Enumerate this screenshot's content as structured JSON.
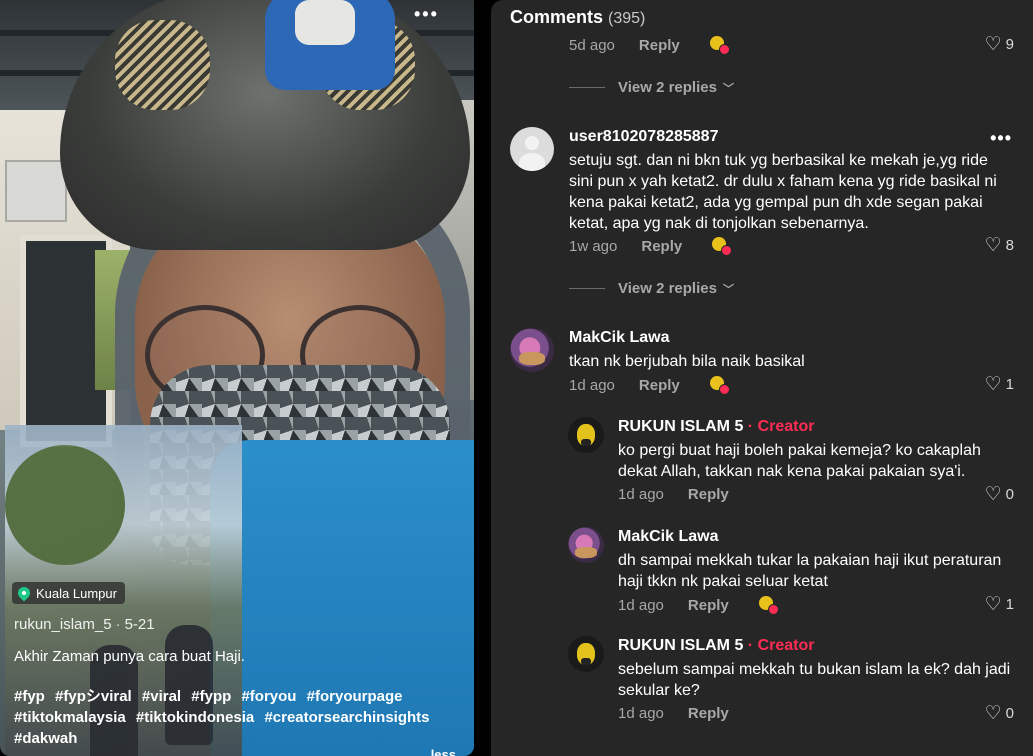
{
  "video": {
    "location": "Kuala Lumpur",
    "author": "rukun_islam_5",
    "date": "5-21",
    "caption": "Akhir Zaman punya cara buat Haji.",
    "hashtags": [
      "#fyp",
      "#fypシviral",
      "#viral",
      "#fypp",
      "#foryou",
      "#foryourpage",
      "#tiktokmalaysia",
      "#tiktokindonesia",
      "#creatorsearchinsights",
      "#dakwah"
    ],
    "more_label": "less"
  },
  "comments_panel": {
    "title": "Comments",
    "count": "(395)",
    "partial_top": {
      "time": "5d ago",
      "reply": "Reply",
      "likes": "9"
    },
    "view_replies_1": "View 2 replies",
    "comment_1": {
      "username": "user8102078285887",
      "text": "setuju sgt. dan ni bkn tuk yg berbasikal ke mekah je,yg ride sini pun x yah ketat2. dr dulu x faham kena yg ride basikal ni kena pakai ketat2, ada yg gempal pun dh xde segan pakai ketat, apa yg nak di tonjolkan sebenarnya.",
      "time": "1w ago",
      "reply": "Reply",
      "likes": "8"
    },
    "view_replies_2": "View 2 replies",
    "comment_2": {
      "username": "MakCik Lawa",
      "text": "tkan nk berjubah bila naik basikal",
      "time": "1d ago",
      "reply": "Reply",
      "likes": "1"
    },
    "reply_1": {
      "username": "RUKUN ISLAM 5",
      "creator_label": "· Creator",
      "text": "ko pergi buat haji boleh pakai kemeja? ko cakaplah dekat Allah, takkan nak kena pakai pakaian sya'i.",
      "time": "1d ago",
      "reply": "Reply",
      "likes": "0"
    },
    "reply_2": {
      "username": "MakCik Lawa",
      "text": "dh sampai mekkah tukar la pakaian haji ikut peraturan haji tkkn nk pakai seluar ketat",
      "time": "1d ago",
      "reply": "Reply",
      "likes": "1"
    },
    "reply_3": {
      "username": "RUKUN ISLAM 5",
      "creator_label": "· Creator",
      "text": "sebelum sampai mekkah tu bukan islam la ek? dah jadi sekular ke?",
      "time": "1d ago",
      "reply": "Reply",
      "likes": "0"
    }
  }
}
